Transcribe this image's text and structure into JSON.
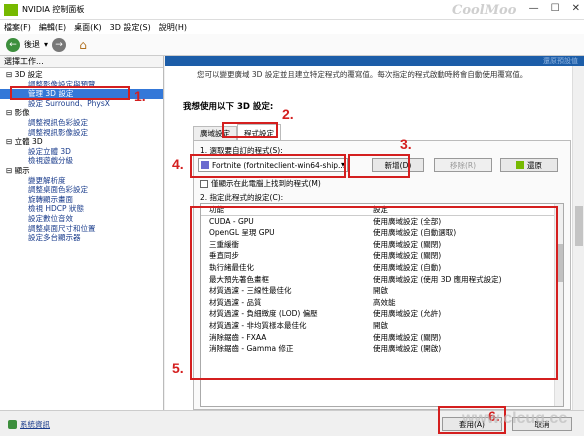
{
  "window": {
    "title": "NVIDIA 控制面板",
    "watermark": "CoolMoo",
    "min_glyph": "—",
    "max_glyph": "☐",
    "close_glyph": "✕"
  },
  "menu": [
    "檔案(F)",
    "編輯(E)",
    "桌面(K)",
    "3D 設定(S)",
    "說明(H)"
  ],
  "toolbar": {
    "back_label": "後退",
    "back_glyph": "←",
    "fwd_glyph": "→",
    "dropdown_glyph": "▾",
    "home_glyph": "⌂"
  },
  "sidebar": {
    "header": "選擇工作...",
    "tree": [
      {
        "label": "⊟ 3D 設定",
        "type": "cat"
      },
      {
        "label": "調整影像設定與預覽",
        "type": "item"
      },
      {
        "label": "管理 3D 設定",
        "type": "item",
        "selected": true
      },
      {
        "label": "設定 Surround、PhysX",
        "type": "item"
      },
      {
        "label": "⊟ 影像",
        "type": "cat"
      },
      {
        "label": "調整視訊色彩設定",
        "type": "item"
      },
      {
        "label": "調整視訊影像設定",
        "type": "item"
      },
      {
        "label": "⊟ 立體 3D",
        "type": "cat"
      },
      {
        "label": "設定立體 3D",
        "type": "item"
      },
      {
        "label": "檢視遊戲分級",
        "type": "item"
      },
      {
        "label": "⊟ 顯示",
        "type": "cat"
      },
      {
        "label": "變更解析度",
        "type": "item"
      },
      {
        "label": "調整桌面色彩設定",
        "type": "item"
      },
      {
        "label": "旋轉顯示畫面",
        "type": "item"
      },
      {
        "label": "檢視 HDCP 狀態",
        "type": "item"
      },
      {
        "label": "設定數位音效",
        "type": "item"
      },
      {
        "label": "調整桌面尺寸和位置",
        "type": "item"
      },
      {
        "label": "設定多台顯示器",
        "type": "item"
      }
    ]
  },
  "main": {
    "top_link": "還原預設值",
    "description": "您可以變更廣域 3D 設定並且建立特定程式的覆寫值。每次指定的程式啟動時將會自動使用覆寫值。",
    "heading": "我想使用以下 3D 設定:",
    "tabs": [
      "廣域設定",
      "程式設定"
    ],
    "program_label": "1. 選取要自訂的程式(S):",
    "program_selected": "Fortnite (fortniteclient-win64-ship...",
    "program_arrow": "▾",
    "add_button": "新增(D)",
    "remove_button": "移除(R)",
    "restore_button": "還原",
    "checkbox_label": "僅顯示在此電腦上找到的程式(M)",
    "features_label": "2. 指定此程式的設定(C):",
    "table_header": [
      "功能",
      "設定"
    ],
    "features": [
      [
        "CUDA - GPU",
        "使用廣域設定 (全部)"
      ],
      [
        "OpenGL 呈現 GPU",
        "使用廣域設定 (自動選取)"
      ],
      [
        "三重緩衝",
        "使用廣域設定 (關閉)"
      ],
      [
        "垂直同步",
        "使用廣域設定 (關閉)"
      ],
      [
        "執行緒最佳化",
        "使用廣域設定 (自動)"
      ],
      [
        "最大預先著色畫框",
        "使用廣域設定 (使用 3D 應用程式設定)"
      ],
      [
        "材質過濾 - 三線性最佳化",
        "開啟"
      ],
      [
        "材質過濾 - 品質",
        "高效能"
      ],
      [
        "材質過濾 - 負細緻度 (LOD) 偏壓",
        "使用廣域設定 (允許)"
      ],
      [
        "材質過濾 - 非均質樣本最佳化",
        "開啟"
      ],
      [
        "消除鋸齒 - FXAA",
        "使用廣域設定 (關閉)"
      ],
      [
        "消除鋸齒 - Gamma 修正",
        "使用廣域設定 (開啟)"
      ]
    ]
  },
  "statusbar": {
    "system_info": "系統資訊",
    "apply_button": "套用(A)",
    "cancel_button": "取消"
  },
  "annotations": [
    "1.",
    "2.",
    "3.",
    "4.",
    "5.",
    "6."
  ],
  "site_watermark": "www.clcug.cc",
  "colors": {
    "annotation": "#d41f1f",
    "selection": "#3478d8",
    "nvidia_green": "#76b900",
    "header_blue": "#1c5da8"
  }
}
